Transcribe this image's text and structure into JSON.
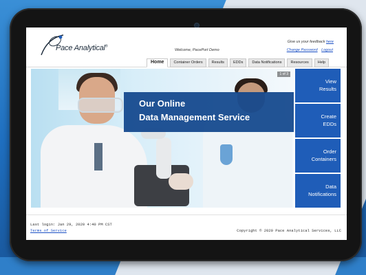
{
  "header": {
    "logo_text": "Pace Analytical",
    "logo_mark": "®",
    "welcome": "Welcome, PacePort Demo",
    "feedback_text": "Give us your feedback",
    "feedback_link": "here",
    "change_password": "Change Password",
    "logout": "Logout"
  },
  "nav": {
    "tabs": [
      "Home",
      "Container Orders",
      "Results",
      "EDDs",
      "Data Notifications",
      "Resources",
      "Help"
    ]
  },
  "hero": {
    "banner_line1": "Our Online",
    "banner_line2": "Data Management Service",
    "slide_indicator": "1 of 3"
  },
  "side_buttons": [
    {
      "line1": "View",
      "line2": "Results"
    },
    {
      "line1": "Create",
      "line2": "EDDs"
    },
    {
      "line1": "Order",
      "line2": "Containers"
    },
    {
      "line1": "Data",
      "line2": "Notifications"
    }
  ],
  "footer": {
    "last_login": "Last login: Jan 29, 2020 4:40 PM CST",
    "terms": "Terms of Service",
    "copyright": "Copyright © 2020 Pace Analytical Services, LLC"
  },
  "colors": {
    "accent": "#1f5db8",
    "banner": "#11468c",
    "link": "#1a4fc4"
  }
}
